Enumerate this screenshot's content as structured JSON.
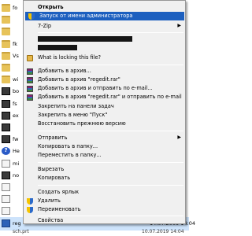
{
  "background": {
    "rows": [
      {
        "label": "fo",
        "icon": "folder-icon"
      },
      {
        "label": "",
        "icon": "folder-icon"
      },
      {
        "label": "",
        "icon": "folder-icon"
      },
      {
        "label": "fk",
        "icon": "folder-icon"
      },
      {
        "label": "Vs",
        "icon": "folder-icon"
      },
      {
        "label": "",
        "icon": "folder-icon"
      },
      {
        "label": "wi",
        "icon": "folder-icon"
      },
      {
        "label": "bo",
        "icon": "exe-icon"
      },
      {
        "label": "fs",
        "icon": "exe-icon"
      },
      {
        "label": "ex",
        "icon": "exe-icon"
      },
      {
        "label": "",
        "icon": "exe-icon"
      },
      {
        "label": "fw",
        "icon": "exe-icon"
      },
      {
        "label": "He",
        "icon": "help-icon"
      },
      {
        "label": "mi",
        "icon": "doc-icon"
      },
      {
        "label": "no",
        "icon": "exe-icon"
      },
      {
        "label": "",
        "icon": "doc-icon"
      },
      {
        "label": "",
        "icon": "doc-icon"
      },
      {
        "label": "",
        "icon": "doc-icon"
      }
    ],
    "selected_row": {
      "label": "reg",
      "date": "14.07.2009 14:04"
    },
    "bottom_row": {
      "label": "sch.prt",
      "date": "10.07.2019 14:04"
    }
  },
  "menu": {
    "open": "Открыть",
    "run_as_admin": "Запуск от имени администратора",
    "seven_zip": "7-Zip",
    "what_locking": "What is locking this file?",
    "add_archive": "Добавить в архив...",
    "add_regedit_rar": "Добавить в архив \"regedit.rar\"",
    "add_archive_email": "Добавить в архив и отправить по e-mail...",
    "add_regedit_email": "Добавить в архив \"regedit.rar\" и отправить по e-mail",
    "pin_taskbar": "Закрепить на панели задач",
    "pin_start": "Закрепить в меню \"Пуск\"",
    "restore_previous": "Восстановить прежнюю версию",
    "send_to": "Отправить",
    "copy_to": "Копировать в папку...",
    "move_to": "Переместить в папку...",
    "cut": "Вырезать",
    "copy": "Копировать",
    "create_shortcut": "Создать ярлык",
    "delete": "Удалить",
    "rename": "Переименовать",
    "properties": "Свойства",
    "submenu_arrow": "▶"
  }
}
